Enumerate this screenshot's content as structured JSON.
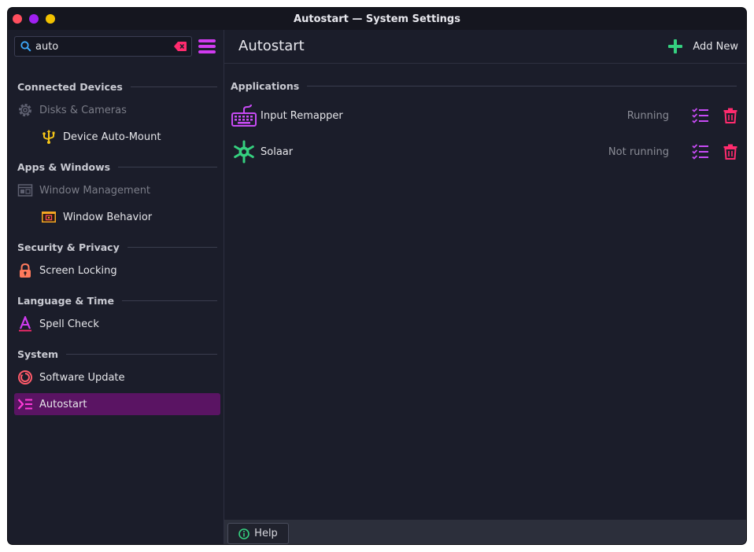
{
  "window": {
    "title": "Autostart — System Settings"
  },
  "search": {
    "value": "auto"
  },
  "sidebar": {
    "sections": [
      {
        "header": "Connected Devices"
      },
      {
        "header": "Apps & Windows"
      },
      {
        "header": "Security & Privacy"
      },
      {
        "header": "Language & Time"
      },
      {
        "header": "System"
      }
    ],
    "items": {
      "disks_cameras": "Disks & Cameras",
      "device_automount": "Device Auto-Mount",
      "window_management": "Window Management",
      "window_behavior": "Window Behavior",
      "screen_locking": "Screen Locking",
      "spell_check": "Spell Check",
      "software_update": "Software Update",
      "autostart": "Autostart"
    }
  },
  "main": {
    "title": "Autostart",
    "add_new": "Add New",
    "applications_header": "Applications",
    "apps": [
      {
        "name": "Input Remapper",
        "status": "Running"
      },
      {
        "name": "Solaar",
        "status": "Not running"
      }
    ],
    "help": "Help"
  },
  "colors": {
    "accent": "#5a1463",
    "purple": "#c84bf5",
    "delete": "#ff2b6e",
    "green": "#35d07f"
  }
}
